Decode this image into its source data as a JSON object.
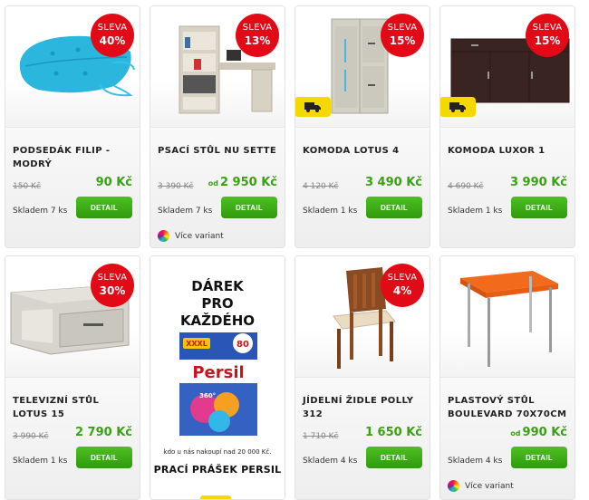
{
  "labels": {
    "sleva": "SLEVA",
    "detail": "DETAIL",
    "od": "od",
    "variants": "Více variant"
  },
  "products": [
    {
      "name": "PODSEDÁK FILIP - MODRÝ",
      "old_price": "150 Kč",
      "price": "90 Kč",
      "stock": "Skladem 7 ks",
      "discount": "40%"
    },
    {
      "name": "PSACÍ STŮL NU SETTE",
      "old_price": "3 390 Kč",
      "price": "2 950 Kč",
      "stock": "Skladem 7 ks",
      "discount": "13%"
    },
    {
      "name": "KOMODA LOTUS 4",
      "old_price": "4 120 Kč",
      "price": "3 490 Kč",
      "stock": "Skladem 1 ks",
      "discount": "15%"
    },
    {
      "name": "KOMODA LUXOR 1",
      "old_price": "4 690 Kč",
      "price": "3 990 Kč",
      "stock": "Skladem 1 ks",
      "discount": "15%"
    },
    {
      "name": "TELEVIZNÍ STŮL LOTUS 15",
      "old_price": "3 990 Kč",
      "price": "2 790 Kč",
      "stock": "Skladem 1 ks",
      "discount": "30%"
    },
    {
      "name": "JÍDELNÍ ŽIDLE POLLY 312",
      "old_price": "1 710 Kč",
      "price": "1 650 Kč",
      "stock": "Skladem 4 ks",
      "discount": "4%"
    },
    {
      "name": "PLASTOVÝ STŮL BOULEVARD 70X70CM",
      "price": "990 Kč",
      "stock": "Skladem 4 ks"
    }
  ],
  "promo": {
    "headline": "DÁREK PRO KAŽDÉHO",
    "note": "kdo u nás nakoupí nad 20 000 Kč.",
    "product": "PRACÍ PRÁŠEK PERSIL",
    "brand": "Persil",
    "pack_text": "XXXL",
    "pack_count": "80",
    "pack_sub": "360°"
  },
  "colors": {
    "badge": "#e20a17",
    "price": "#3aa212",
    "button": "#2f9a0e",
    "delivery": "#f5d800"
  },
  "icons": {
    "delivery": "truck-icon",
    "variants": "color-wheel-icon"
  }
}
